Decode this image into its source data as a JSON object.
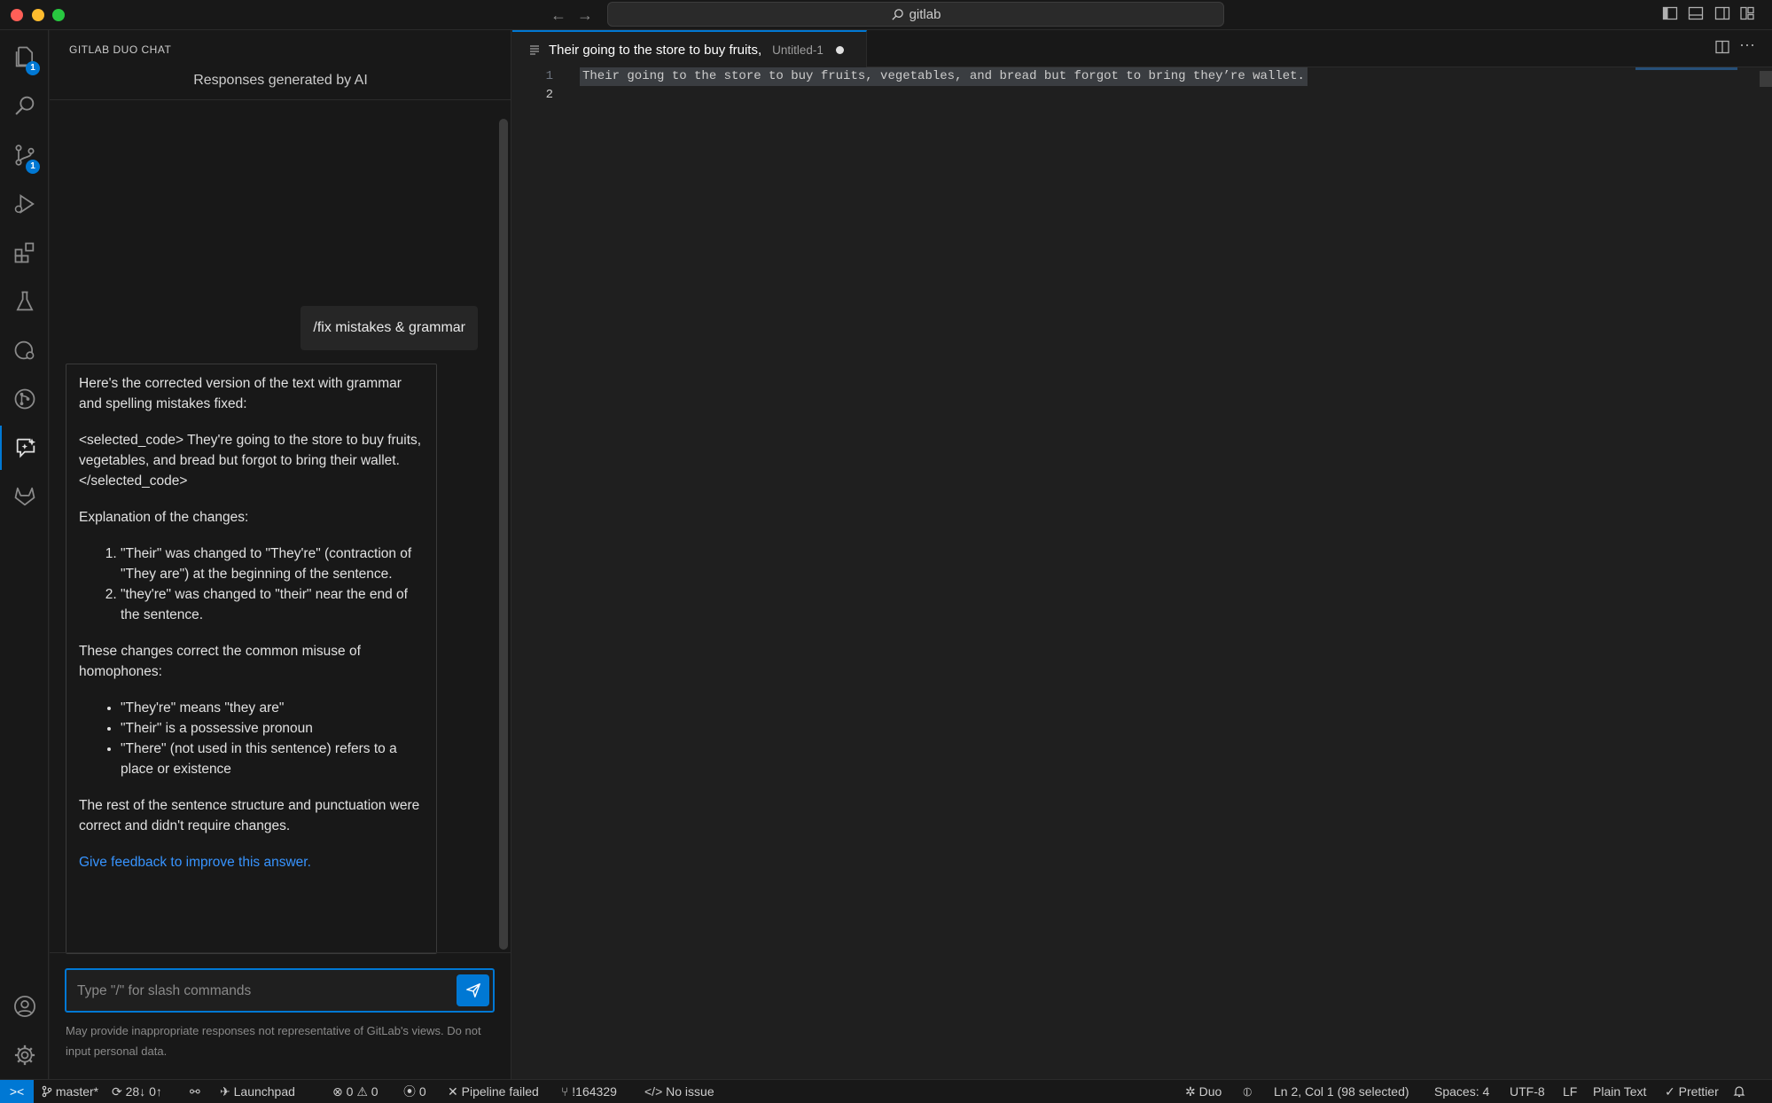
{
  "titlebar": {
    "search": "gitlab",
    "icons": [
      "toggle-primary-sidebar-icon",
      "toggle-panel-icon",
      "toggle-secondary-sidebar-icon",
      "customize-layout-icon"
    ]
  },
  "activity_bar": {
    "explorer_badge": "1",
    "scm_badge": "1"
  },
  "chat": {
    "title": "GITLAB DUO CHAT",
    "subtitle": "Responses generated by AI",
    "user_message": "/fix mistakes & grammar",
    "response": {
      "intro": "Here's the corrected version of the text with grammar and spelling mistakes fixed:",
      "corrected": "<selected_code> They're going to the store to buy fruits, vegetables, and bread but forgot to bring their wallet. </selected_code>",
      "explanation_heading": "Explanation of the changes:",
      "changes": [
        "\"Their\" was changed to \"They're\" (contraction of \"They are\") at the beginning of the sentence.",
        "\"they're\" was changed to \"their\" near the end of the sentence."
      ],
      "homophones_heading": "These changes correct the common misuse of homophones:",
      "homophones": [
        "\"They're\" means \"they are\"",
        "\"Their\" is a possessive pronoun",
        "\"There\" (not used in this sentence) refers to a place or existence"
      ],
      "conclusion": "The rest of the sentence structure and punctuation were correct and didn't require changes.",
      "feedback": "Give feedback to improve this answer."
    },
    "input_placeholder": "Type \"/\" for slash commands",
    "disclaimer": "May provide inappropriate responses not representative of GitLab's views. Do not input personal data."
  },
  "editor": {
    "tab_title": "Their going to the store to buy fruits,",
    "tab_description": "Untitled-1",
    "lines": [
      {
        "number": "1",
        "text": "Their going to the store to buy fruits, vegetables, and bread but forgot to bring they’re wallet."
      },
      {
        "number": "2",
        "text": ""
      }
    ]
  },
  "statusbar": {
    "branch": "master*",
    "sync": "28↓ 0↑",
    "launchpad": "Launchpad",
    "errors": "0",
    "warnings": "0",
    "ports": "0",
    "pipeline": "Pipeline failed",
    "merge_request": "!164329",
    "issue": "No issue",
    "duo": "Duo",
    "cursor": "Ln 2, Col 1 (98 selected)",
    "spaces": "Spaces: 4",
    "encoding": "UTF-8",
    "eol": "LF",
    "language": "Plain Text",
    "prettier": "Prettier"
  }
}
